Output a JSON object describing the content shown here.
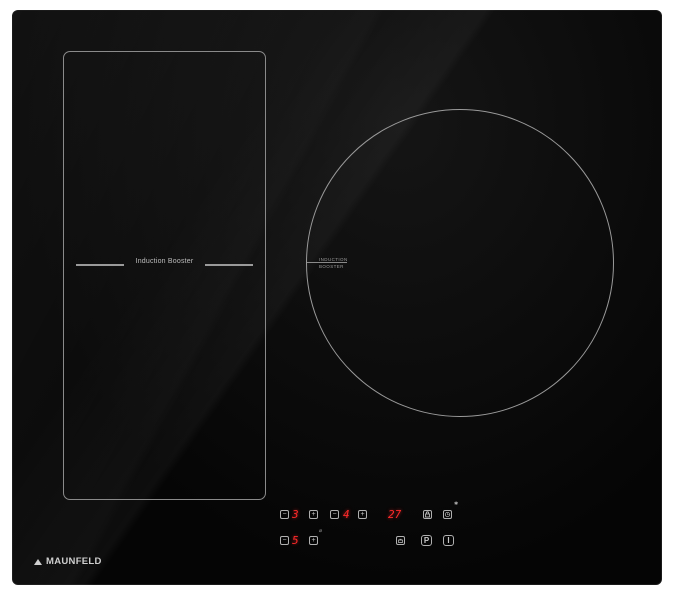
{
  "cooktop": {
    "flex_zone_label": "Induction Booster",
    "round_zone_label_line1": "INDUCTION",
    "round_zone_label_line2": "BOOSTER",
    "brand": "MAUNFELD"
  },
  "controls": {
    "minus": "−",
    "plus": "+",
    "zone1_level": "3",
    "zone2_level": "4",
    "zone3_level": "5",
    "timer_value": "27",
    "pause_label": "P",
    "power_label": "I"
  },
  "colors": {
    "glass": "#060606",
    "display_red": "#ff2a2a",
    "print_grey": "#9a9a9a"
  }
}
